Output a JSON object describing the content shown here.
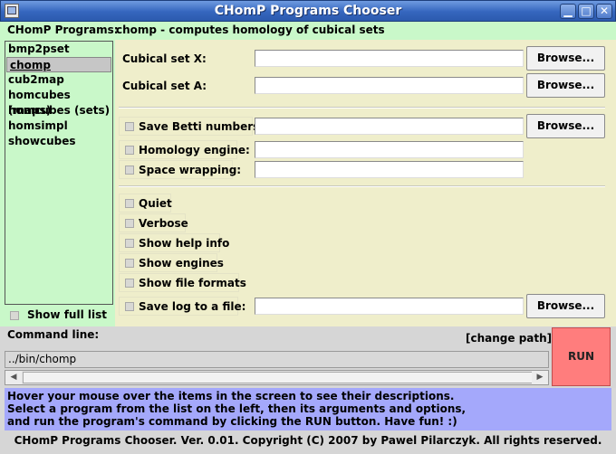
{
  "window": {
    "title": "CHomP Programs Chooser"
  },
  "programs": {
    "label": "CHomP Programs:",
    "description": "chomp - computes homology of cubical sets",
    "items": [
      "bmp2pset",
      "chomp",
      "cub2map",
      "homcubes (maps)",
      "homcubes (sets)",
      "homsimpl",
      "showcubes"
    ],
    "selected": "chomp",
    "show_full_list_label": "Show full list"
  },
  "fields": {
    "cubical_x_label": "Cubical set X:",
    "cubical_a_label": "Cubical set A:",
    "browse_label": "Browse..."
  },
  "options": {
    "save_betti": "Save Betti numbers:",
    "homology_engine": "Homology engine:",
    "space_wrapping": "Space wrapping:",
    "quiet": "Quiet",
    "verbose": "Verbose",
    "show_help_info": "Show help info",
    "show_engines": "Show engines",
    "show_file_formats": "Show file formats",
    "save_log": "Save log to a file:"
  },
  "command": {
    "label": "Command line:",
    "change_path": "[change path]",
    "value": "../bin/chomp",
    "run_label": "RUN"
  },
  "help": {
    "line1": "Hover your mouse over the items in the screen to see their descriptions.",
    "line2": "Select a program from the list on the left, then its arguments and options,",
    "line3": "and run the program's command by clicking the RUN button. Have fun! :)"
  },
  "footer": "CHomP Programs Chooser. Ver. 0.01. Copyright (C) 2007 by Pawel Pilarczyk. All rights reserved."
}
